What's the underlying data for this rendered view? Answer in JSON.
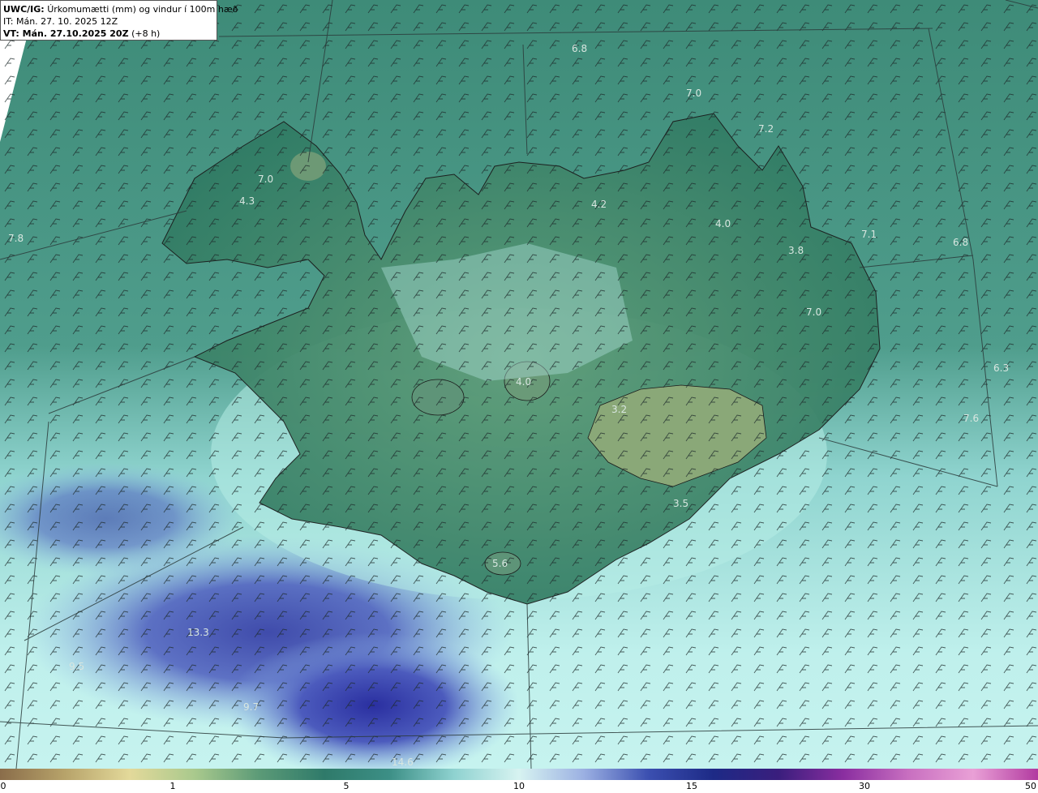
{
  "header": {
    "product": "UWC/IG:",
    "description": "Úrkomumætti (mm) og vindur í 100m hæð",
    "initial_time": "IT: Mán. 27. 10. 2025 12Z",
    "valid_prefix": "VT: Mán. 27.10.2025 20Z",
    "valid_offset": "(+8 h)"
  },
  "colorbar": {
    "ticks": [
      "0",
      "1",
      "5",
      "10",
      "15",
      "30",
      "50"
    ],
    "colors": [
      "#8a6d4a",
      "#b7a36a",
      "#e3d99a",
      "#a9c98d",
      "#5b9a77",
      "#2f7a6a",
      "#3c8f86",
      "#8fd2d0",
      "#d7f3f1",
      "#9bb0e2",
      "#3b4fb0",
      "#1d2a86",
      "#3a1e7d",
      "#8a2ea0",
      "#c86fc0",
      "#e9a0d6",
      "#b23aa0"
    ]
  },
  "map": {
    "labels": [
      {
        "text": "6.8"
      },
      {
        "text": "7.0"
      },
      {
        "text": "7.2"
      },
      {
        "text": "7.0"
      },
      {
        "text": "4.3"
      },
      {
        "text": "4.2"
      },
      {
        "text": "4.0"
      },
      {
        "text": "3.8"
      },
      {
        "text": "7.1"
      },
      {
        "text": "6.8"
      },
      {
        "text": "7.8"
      },
      {
        "text": "7.0"
      },
      {
        "text": "4.0"
      },
      {
        "text": "3.2"
      },
      {
        "text": "6.3"
      },
      {
        "text": "7.6"
      },
      {
        "text": "3.5"
      },
      {
        "text": "5.6"
      },
      {
        "text": "13.3"
      },
      {
        "text": "9.5"
      },
      {
        "text": "9.7"
      },
      {
        "text": "14.6"
      }
    ]
  }
}
